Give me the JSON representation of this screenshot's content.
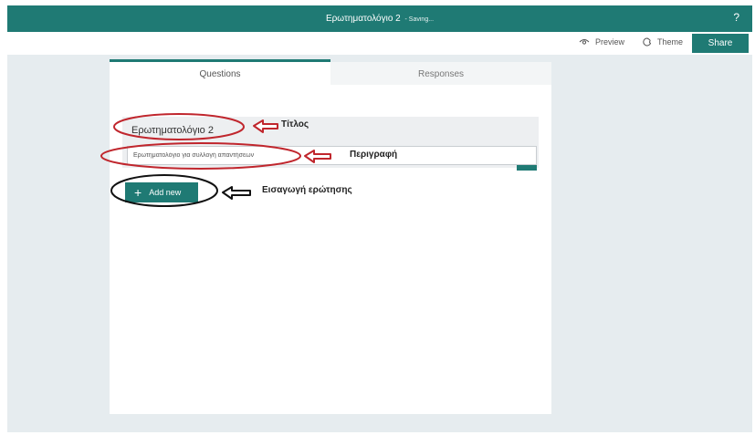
{
  "app": {
    "title": "Ερωτηματολόγιο 2",
    "status": "- Saving...",
    "help_label": "?"
  },
  "commandbar": {
    "preview_label": "Preview",
    "theme_label": "Theme",
    "share_label": "Share"
  },
  "tabs": [
    {
      "label": "Questions",
      "active": true
    },
    {
      "label": "Responses",
      "active": false
    }
  ],
  "form": {
    "title_value": "Ερωτηματολόγιο 2",
    "description_value": "Ερωτηματολόγιο για συλλογή απαντήσεων",
    "add_new_label": "Add new"
  },
  "annotations": {
    "title_label": "Τίτλος",
    "description_label": "Περιγραφή",
    "add_question_label": "Εισαγωγή ερώτησης"
  },
  "colors": {
    "brand": "#1f7a74",
    "background": "#e6ecef",
    "annotation_red": "#c0262d",
    "annotation_black": "#111111"
  },
  "icons": {
    "preview": "eye-icon",
    "theme": "palette-icon",
    "edit": "edit-image-icon",
    "add": "plus-icon"
  }
}
